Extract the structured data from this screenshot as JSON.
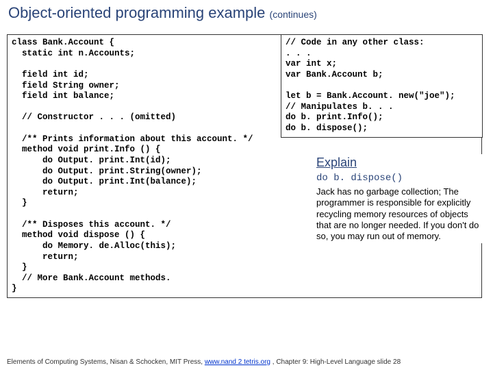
{
  "title": "Object-oriented programming example",
  "continues": "(continues)",
  "codeMain": "class Bank.Account {\n  static int n.Accounts;\n\n  field int id;\n  field String owner;\n  field int balance;\n\n  // Constructor . . . (omitted)\n\n  /** Prints information about this account. */\n  method void print.Info () {\n      do Output. print.Int(id);\n      do Output. print.String(owner);\n      do Output. print.Int(balance);\n      return;\n  }\n\n  /** Disposes this account. */\n  method void dispose () {\n      do Memory. de.Alloc(this);\n      return;\n  }\n  // More Bank.Account methods.\n}",
  "codeRight": "// Code in any other class:\n. . .\nvar int x;\nvar Bank.Account b;\n\nlet b = Bank.Account. new(\"joe\");\n// Manipulates b. . .\ndo b. print.Info();\ndo b. dispose();",
  "explain": {
    "title": "Explain",
    "code": "do b. dispose()",
    "text": "Jack has no garbage collection; The programmer is responsible for explicitly recycling memory resources of objects that are no longer needed.  If you don't do so, you may run out of memory."
  },
  "footer": {
    "prefix": "Elements of Computing Systems, Nisan & Schocken, MIT Press, ",
    "link": "www.nand 2 tetris.org",
    "suffix": " , Chapter 9: High-Level Language slide 28"
  }
}
